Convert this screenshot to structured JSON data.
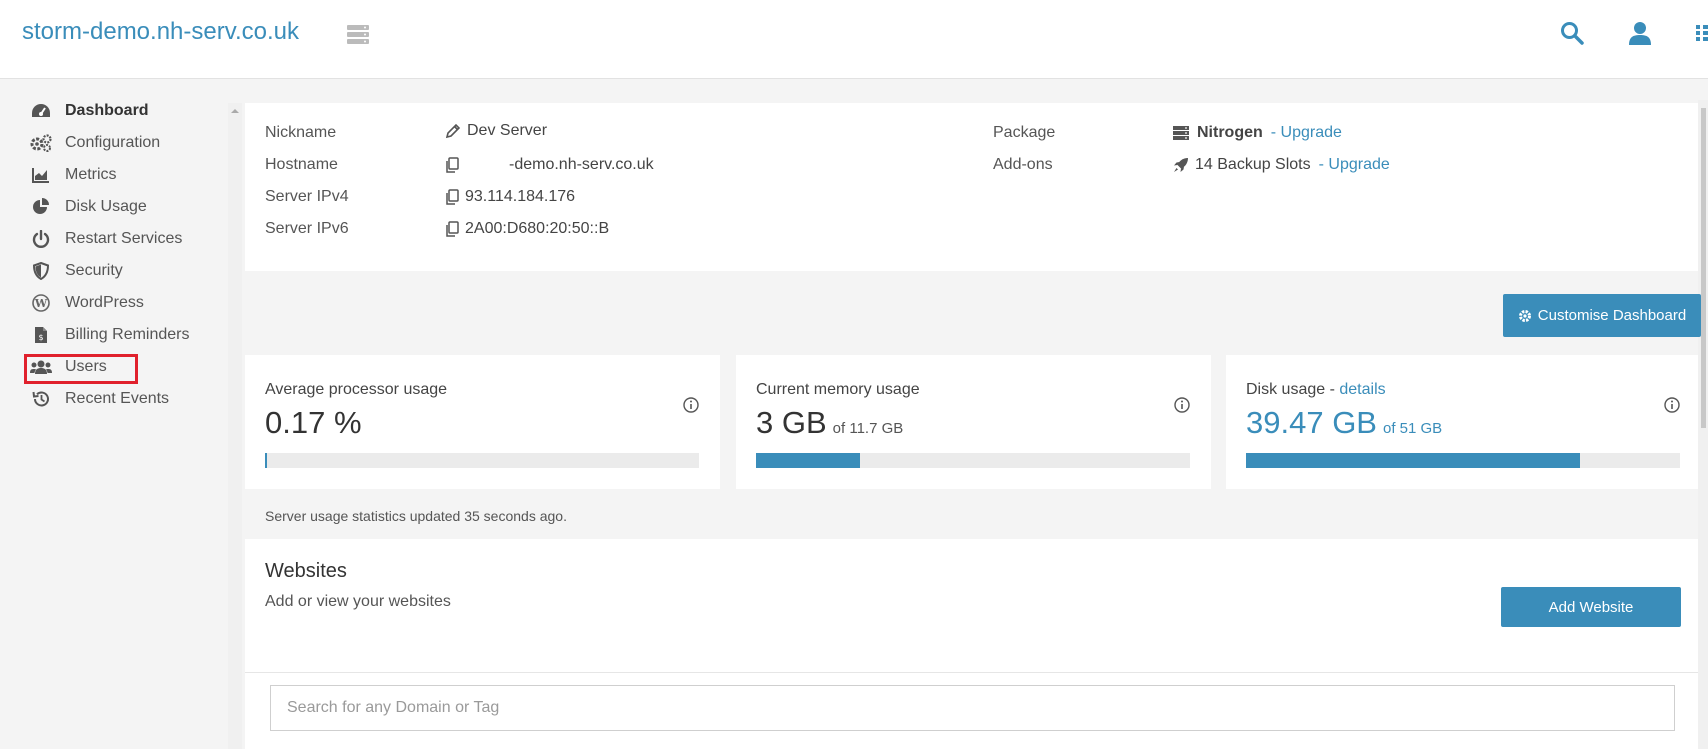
{
  "header": {
    "brand": "storm-demo.nh-serv.co.uk"
  },
  "sidebar": {
    "items": [
      {
        "label": "Dashboard",
        "icon": "gauge-icon",
        "active": true
      },
      {
        "label": "Configuration",
        "icon": "gears-icon"
      },
      {
        "label": "Metrics",
        "icon": "area-chart-icon"
      },
      {
        "label": "Disk Usage",
        "icon": "pie-chart-icon"
      },
      {
        "label": "Restart Services",
        "icon": "power-icon"
      },
      {
        "label": "Security",
        "icon": "shield-icon"
      },
      {
        "label": "WordPress",
        "icon": "wordpress-icon"
      },
      {
        "label": "Billing Reminders",
        "icon": "invoice-icon"
      },
      {
        "label": "Users",
        "icon": "users-icon"
      },
      {
        "label": "Recent Events",
        "icon": "history-icon"
      }
    ]
  },
  "server": {
    "nickname_label": "Nickname",
    "nickname": "Dev Server",
    "hostname_label": "Hostname",
    "hostname": "-demo.nh-serv.co.uk",
    "ipv4_label": "Server IPv4",
    "ipv4": "93.114.184.176",
    "ipv6_label": "Server IPv6",
    "ipv6": "2A00:D680:20:50::B",
    "package_label": "Package",
    "package": "Nitrogen",
    "package_upgrade": "- Upgrade",
    "addons_label": "Add-ons",
    "addons": "14 Backup Slots",
    "addons_upgrade": "- Upgrade"
  },
  "customise_button": "Customise Dashboard",
  "cards": {
    "cpu": {
      "title": "Average processor usage",
      "value": "0.17 %",
      "fill_percent": 0.17
    },
    "memory": {
      "title": "Current memory usage",
      "value": "3 GB",
      "sub": "of 11.7 GB",
      "fill_percent": 24
    },
    "disk": {
      "title": "Disk usage - ",
      "link": "details",
      "value": "39.47 GB",
      "sub": "of 51 GB",
      "fill_percent": 77
    }
  },
  "stats_note": "Server usage statistics updated 35 seconds ago.",
  "websites": {
    "title": "Websites",
    "subtitle": "Add or view your websites",
    "add_button": "Add Website",
    "search_placeholder": "Search for any Domain or Tag"
  },
  "colors": {
    "accent": "#3a8dba",
    "highlight": "#e0202c"
  }
}
